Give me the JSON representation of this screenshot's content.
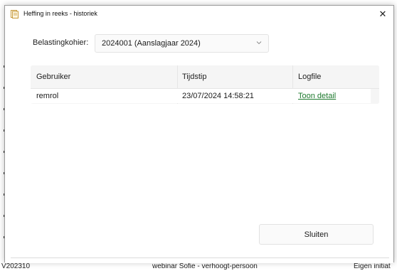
{
  "window": {
    "title": "Heffing in reeks - historiek",
    "close_glyph": "✕"
  },
  "kohier": {
    "label": "Belastingkohier:",
    "selected": "2024001 (Aanslagjaar 2024)"
  },
  "grid": {
    "columns": [
      "Gebruiker",
      "Tijdstip",
      "Logfile"
    ],
    "rows": [
      {
        "gebruiker": "remrol",
        "tijdstip": "23/07/2024 14:58:21",
        "logfile": "Toon detail"
      }
    ]
  },
  "actions": {
    "close_label": "Sluiten"
  },
  "background": {
    "texts": [
      "V202310",
      "webinar Sofie - verhoogt-persoon",
      "Eigen initiat"
    ]
  },
  "icons": {
    "title": "document-icon",
    "dropdown": "chevron-down-icon",
    "close": "close-icon"
  },
  "colors": {
    "link": "#1e7a2e"
  }
}
